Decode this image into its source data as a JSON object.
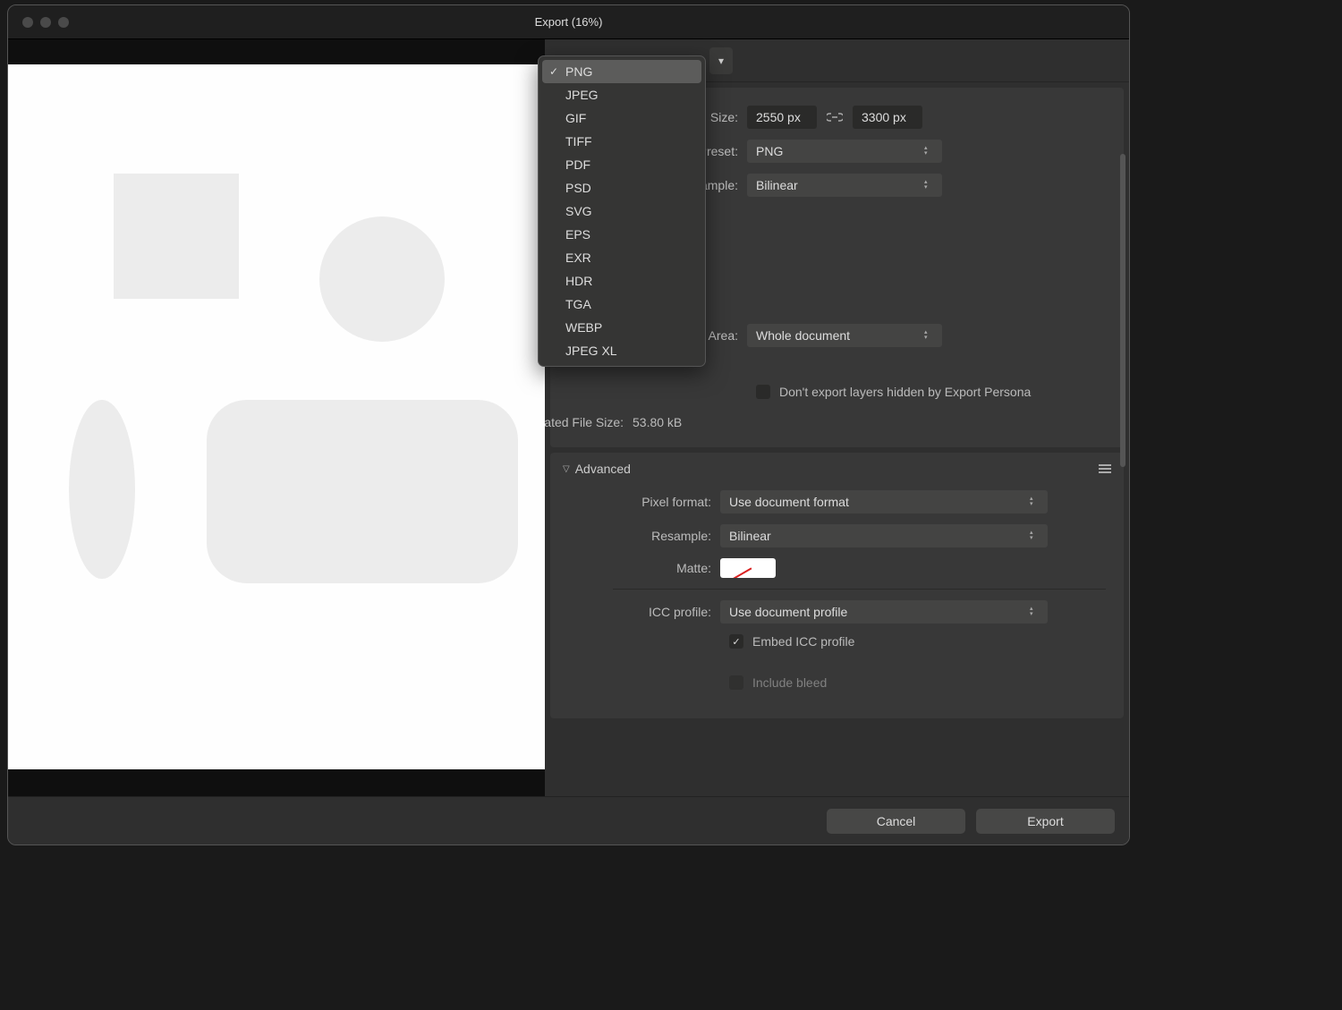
{
  "window": {
    "title": "Export (16%)"
  },
  "dropdown": {
    "items": [
      {
        "label": "PNG",
        "selected": true
      },
      {
        "label": "JPEG",
        "selected": false
      },
      {
        "label": "GIF",
        "selected": false
      },
      {
        "label": "TIFF",
        "selected": false
      },
      {
        "label": "PDF",
        "selected": false
      },
      {
        "label": "PSD",
        "selected": false
      },
      {
        "label": "SVG",
        "selected": false
      },
      {
        "label": "EPS",
        "selected": false
      },
      {
        "label": "EXR",
        "selected": false
      },
      {
        "label": "HDR",
        "selected": false
      },
      {
        "label": "TGA",
        "selected": false
      },
      {
        "label": "WEBP",
        "selected": false
      },
      {
        "label": "JPEG XL",
        "selected": false
      }
    ]
  },
  "basic": {
    "size_label": "Size:",
    "width": "2550 px",
    "height": "3300 px",
    "preset_label": "Preset:",
    "preset_value": "PNG",
    "resample_label": "Resample:",
    "resample_value": "Bilinear",
    "area_label": "Area:",
    "area_value": "Whole document",
    "hidden_layers_label": "Don't export layers hidden by Export Persona",
    "filesize_label": "Estimated File Size:",
    "filesize_value": "53.80 kB"
  },
  "advanced": {
    "header": "Advanced",
    "pixel_format_label": "Pixel format:",
    "pixel_format_value": "Use document format",
    "resample_label": "Resample:",
    "resample_value": "Bilinear",
    "matte_label": "Matte:",
    "icc_label": "ICC profile:",
    "icc_value": "Use document profile",
    "embed_icc_label": "Embed ICC profile",
    "include_bleed_label": "Include bleed"
  },
  "footer": {
    "cancel": "Cancel",
    "export": "Export"
  }
}
